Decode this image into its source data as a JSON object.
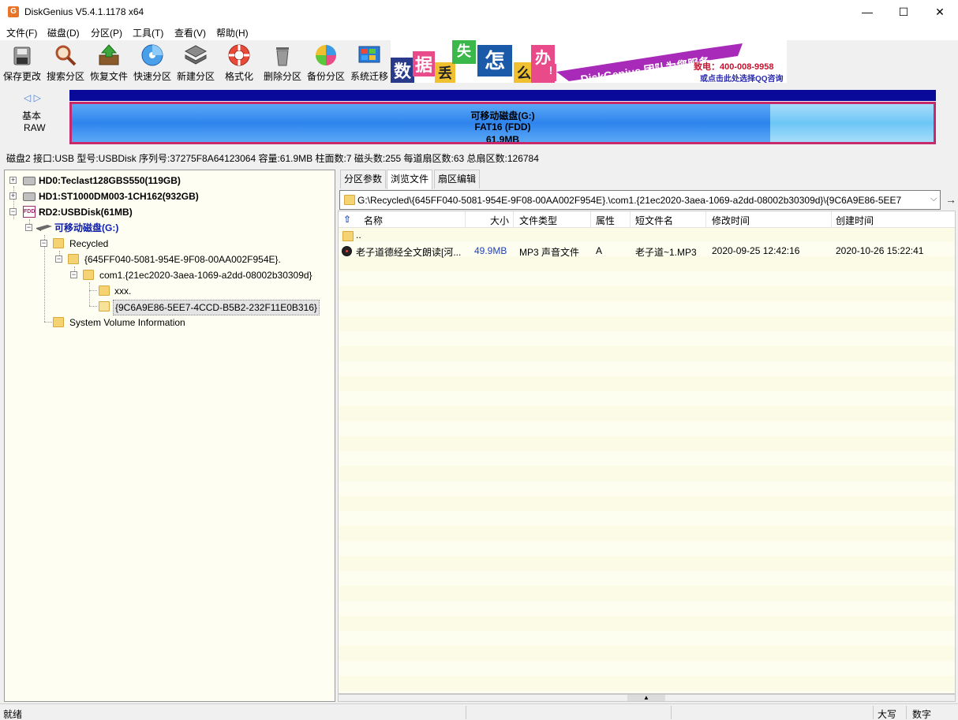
{
  "window": {
    "title": "DiskGenius V5.4.1.1178 x64",
    "icon_letter": "G",
    "minimize": "—",
    "maximize": "☐",
    "close": "✕"
  },
  "menu": [
    "文件(F)",
    "磁盘(D)",
    "分区(P)",
    "工具(T)",
    "查看(V)",
    "帮助(H)"
  ],
  "toolbar": [
    {
      "label": "保存更改",
      "icon": "save-icon"
    },
    {
      "label": "搜索分区",
      "icon": "search-partition-icon"
    },
    {
      "label": "恢复文件",
      "icon": "recover-files-icon"
    },
    {
      "label": "快速分区",
      "icon": "quick-partition-icon"
    },
    {
      "label": "新建分区",
      "icon": "new-partition-icon"
    },
    {
      "label": "格式化",
      "icon": "format-icon"
    },
    {
      "label": "删除分区",
      "icon": "delete-partition-icon"
    },
    {
      "label": "备份分区",
      "icon": "backup-partition-icon"
    },
    {
      "label": "系统迁移",
      "icon": "system-migration-icon"
    }
  ],
  "banner": {
    "chars": [
      "数",
      "据",
      "丢",
      "失",
      "怎",
      "么",
      "办",
      "!"
    ],
    "brand": "DiskGenius 团队为您服务",
    "phone": "致电：400-008-9958",
    "qq": "或点击此处选择QQ咨询"
  },
  "disk_map": {
    "nav_arrows": "◁ ▷",
    "type_label": "基本",
    "format_label": "RAW",
    "partition_name": "可移动磁盘(G:)",
    "filesystem": "FAT16 (FDD)",
    "size": "61.9MB",
    "used_fraction": 0.81,
    "bar_color": "#2e84ee",
    "free_color": "#6cc6f6",
    "border_color": "#c8296a"
  },
  "disk_info": "磁盘2 接口:USB  型号:USBDisk  序列号:37275F8A64123064  容量:61.9MB  柱面数:7  磁头数:255  每道扇区数:63  总扇区数:126784",
  "tree": {
    "hd0": "HD0:Teclast128GBS550(119GB)",
    "hd1": "HD1:ST1000DM003-1CH162(932GB)",
    "rd2": "RD2:USBDisk(61MB)",
    "rd2_icon_text": "FDD",
    "volume": "可移动磁盘(G:)",
    "recycled": "Recycled",
    "sid_folder": "{645FF040-5081-954E-9F08-00AA002F954E}.",
    "com1_folder": "com1.{21ec2020-3aea-1069-a2dd-08002b30309d}",
    "xxx_folder": "xxx.",
    "guid_folder": "{9C6A9E86-5EE7-4CCD-B5B2-232F11E0B316}",
    "svi_folder": "System Volume Information",
    "expand_plus": "+",
    "expand_minus": "−"
  },
  "tabs": [
    "分区参数",
    "浏览文件",
    "扇区编辑"
  ],
  "active_tab": 1,
  "path": {
    "value": "G:\\Recycled\\{645FF040-5081-954E-9F08-00AA002F954E}.\\com1.{21ec2020-3aea-1069-a2dd-08002b30309d}\\{9C6A9E86-5EE7",
    "dropdown": "⌵",
    "go": "→"
  },
  "file_list": {
    "up_icon": "⇧",
    "columns": [
      "名称",
      "大小",
      "文件类型",
      "属性",
      "短文件名",
      "修改时间",
      "创建时间"
    ],
    "parent_entry": "..",
    "rows": [
      {
        "name": "老子道德经全文朗读[河...",
        "size": "49.9MB",
        "type": "MP3 声音文件",
        "attr": "A",
        "short_name": "老子道~1.MP3",
        "modified": "2020-09-25 12:42:16",
        "created": "2020-10-26 15:22:41"
      }
    ]
  },
  "splitter_grip": "▲",
  "status": {
    "text": "就绪",
    "caps": "大写",
    "num": "数字"
  }
}
